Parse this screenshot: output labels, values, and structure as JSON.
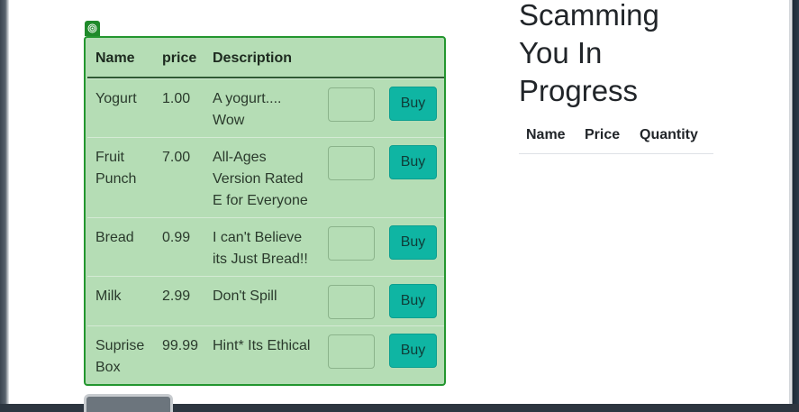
{
  "product_table": {
    "headers": {
      "name": "Name",
      "price": "price",
      "description": "Description"
    },
    "buy_label": "Buy",
    "rows": [
      {
        "name_lines": [
          "Yogurt"
        ],
        "price": "1.00",
        "desc_lines": [
          "A yogurt....",
          "Wow"
        ],
        "quantity": ""
      },
      {
        "name_lines": [
          "Fruit",
          "Punch"
        ],
        "price": "7.00",
        "desc_lines": [
          "All-Ages",
          "Version Rated",
          "E for Everyone"
        ],
        "quantity": ""
      },
      {
        "name_lines": [
          "Bread"
        ],
        "price": "0.99",
        "desc_lines": [
          "I can't Believe",
          "its Just Bread!!"
        ],
        "quantity": ""
      },
      {
        "name_lines": [
          "Milk"
        ],
        "price": "2.99",
        "desc_lines": [
          "Don't Spill"
        ],
        "quantity": ""
      },
      {
        "name_lines": [
          "Suprise",
          "Box"
        ],
        "price": "99.99",
        "desc_lines": [
          "Hint* Its Ethical"
        ],
        "quantity": ""
      }
    ]
  },
  "cart": {
    "title_lines": [
      "Scamming",
      "You In",
      "Progress"
    ],
    "headers": {
      "name": "Name",
      "price": "Price",
      "quantity": "Quantity"
    }
  },
  "colors": {
    "table_bg": "#b5ddb5",
    "table_border": "#23962f",
    "buy_button": "#0fb5a3"
  }
}
